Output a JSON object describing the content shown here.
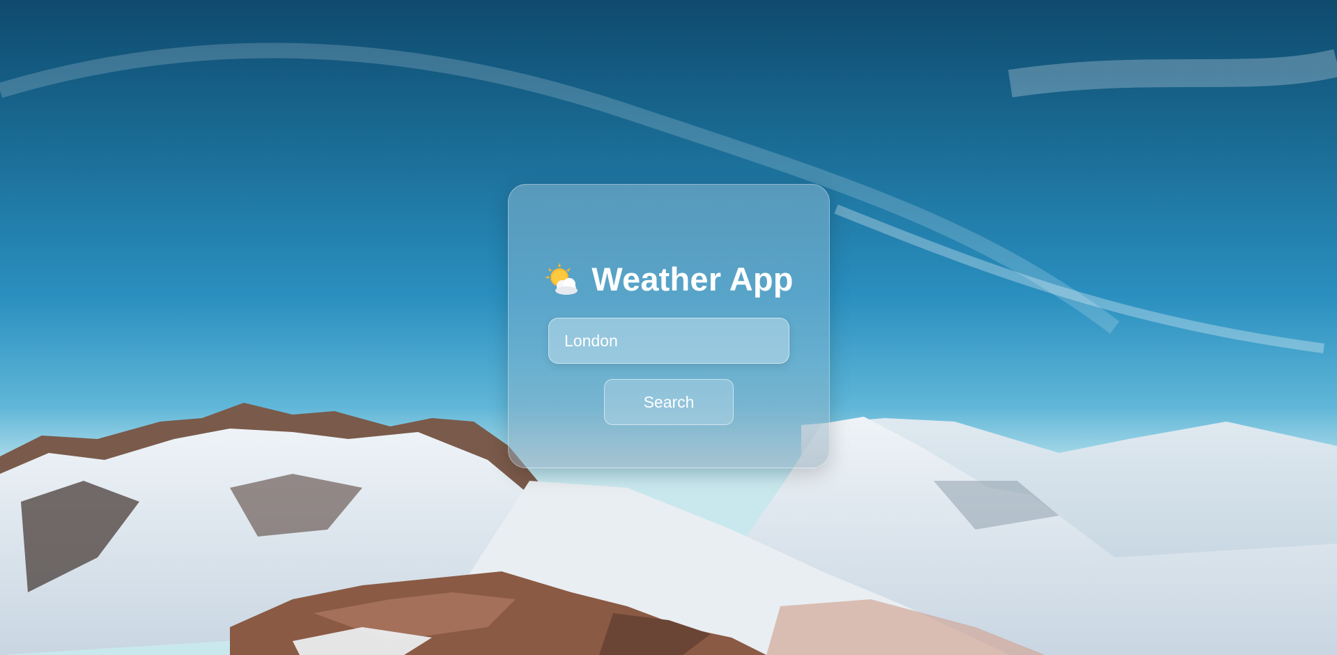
{
  "app": {
    "title": "Weather App",
    "icon": "sun-behind-cloud-icon"
  },
  "search": {
    "value": "London",
    "button_label": "Search"
  },
  "colors": {
    "sky_top": "#0f4a6e",
    "sky_mid": "#2a8fbf",
    "card_text": "#ffffff"
  }
}
